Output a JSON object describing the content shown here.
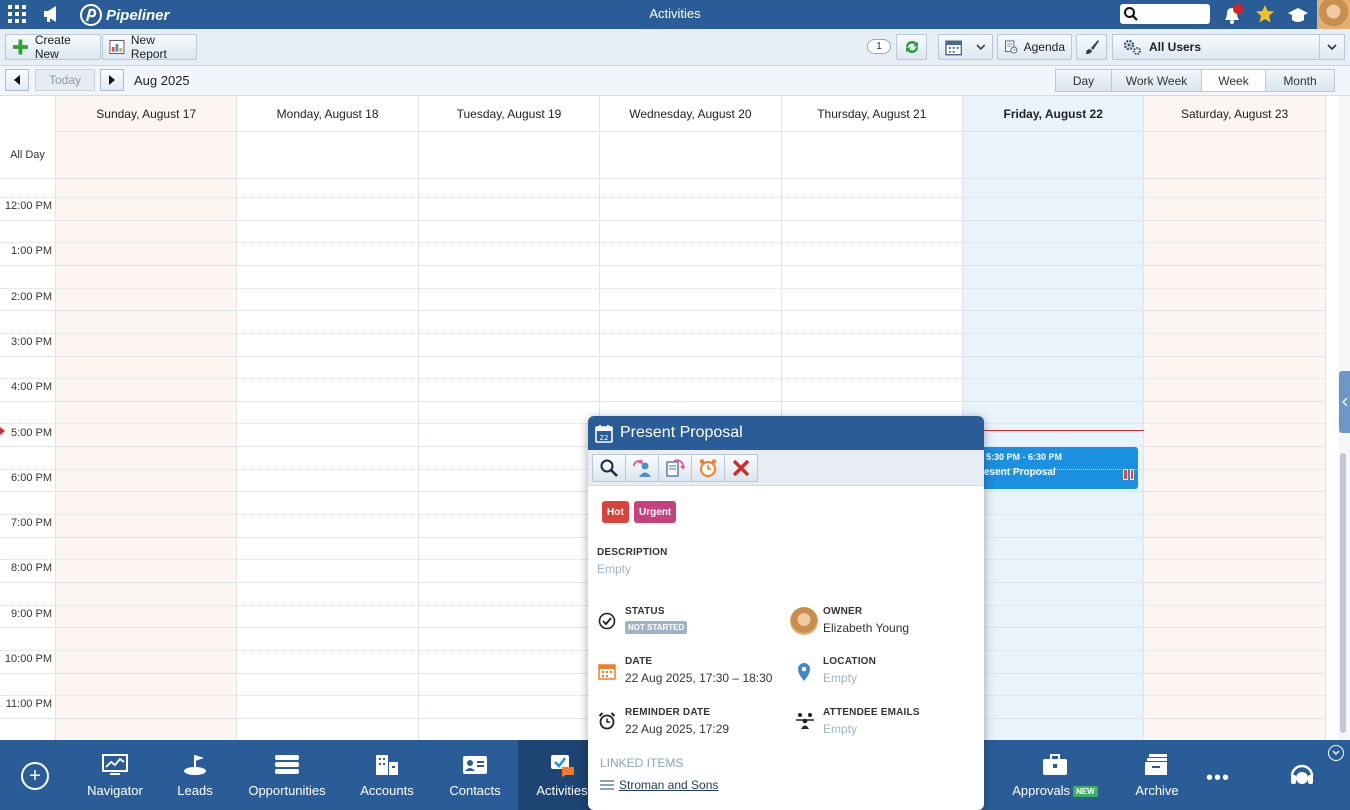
{
  "topbar": {
    "logo_text": "Pipeliner",
    "app_title": "Activities",
    "search_placeholder": ""
  },
  "toolbar": {
    "create_new": "Create New",
    "new_report": "New Report",
    "count": "1",
    "agenda": "Agenda",
    "all_users": "All Users"
  },
  "nav": {
    "today": "Today",
    "period": "Aug 2025",
    "views": [
      "Day",
      "Work Week",
      "Week",
      "Month"
    ],
    "active_view": "Week"
  },
  "calendar": {
    "days": [
      "Sunday, August 17",
      "Monday, August 18",
      "Tuesday, August 19",
      "Wednesday, August 20",
      "Thursday, August 21",
      "Friday, August 22",
      "Saturday, August 23"
    ],
    "today_index": 5,
    "all_day_label": "All Day",
    "times": [
      "12:00 PM",
      "1:00 PM",
      "2:00 PM",
      "3:00 PM",
      "4:00 PM",
      "5:00 PM",
      "6:00 PM",
      "7:00 PM",
      "8:00 PM",
      "9:00 PM",
      "10:00 PM",
      "11:00 PM"
    ],
    "event": {
      "time": "5:30 PM - 6:30 PM",
      "name": "esent Proposal"
    }
  },
  "popup": {
    "title": "Present Proposal",
    "tags": [
      "Hot",
      "Urgent"
    ],
    "description_label": "DESCRIPTION",
    "description_value": "Empty",
    "status_label": "STATUS",
    "status_value": "NOT STARTED",
    "owner_label": "OWNER",
    "owner_value": "Elizabeth Young",
    "date_label": "DATE",
    "date_value": "22 Aug 2025, 17:30 – 18:30",
    "location_label": "LOCATION",
    "location_value": "Empty",
    "reminder_label": "REMINDER DATE",
    "reminder_value": "22 Aug 2025, 17:29",
    "attendee_label": "ATTENDEE EMAILS",
    "attendee_value": "Empty",
    "linked_label": "LINKED ITEMS",
    "linked_item": "Stroman and Sons"
  },
  "bottom_nav": {
    "items": [
      "Navigator",
      "Leads",
      "Opportunities",
      "Accounts",
      "Contacts",
      "Activities",
      "Approvals",
      "Archive"
    ],
    "active": "Activities",
    "new_badge": "NEW"
  },
  "colors": {
    "brand": "#2a5d97",
    "today_column": "#e8f3fb",
    "weekend_column": "#fdf5f1",
    "event": "#1b8fe0",
    "tag_hot": "#d9443a",
    "tag_urgent": "#c8417f",
    "now_line": "#d0282f"
  }
}
